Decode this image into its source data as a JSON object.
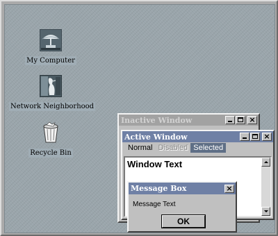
{
  "desktop": {
    "icons": [
      {
        "label": "My Computer",
        "icon": "my-computer-icon"
      },
      {
        "label": "Network Neighborhood",
        "icon": "network-neighborhood-icon"
      },
      {
        "label": "Recycle Bin",
        "icon": "recycle-bin-icon"
      }
    ]
  },
  "inactive_window": {
    "title": "Inactive Window"
  },
  "active_window": {
    "title": "Active Window",
    "menu": {
      "normal": "Normal",
      "disabled": "Disabled",
      "selected": "Selected"
    },
    "window_text": "Window Text"
  },
  "message_box": {
    "title": "Message Box",
    "text": "Message Text",
    "ok_label": "OK"
  },
  "colors": {
    "desktop": "#9aa5ab",
    "active_title": "#6f80a5",
    "inactive_title": "#a2a2a2",
    "selected_menu": "#5f6f86",
    "window_face": "#c0c0c0"
  }
}
